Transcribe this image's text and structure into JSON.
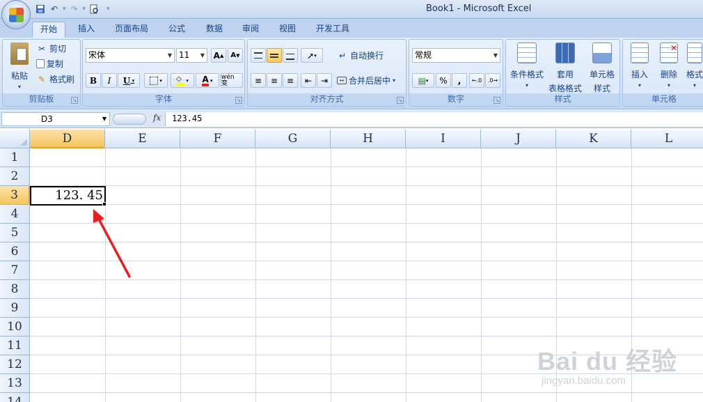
{
  "window": {
    "title": "Book1 - Microsoft Excel"
  },
  "qat": {
    "icons": [
      "save-icon",
      "undo-icon",
      "redo-icon",
      "print-preview-icon",
      "customize-icon"
    ]
  },
  "tabs": [
    "开始",
    "插入",
    "页面布局",
    "公式",
    "数据",
    "审阅",
    "视图",
    "开发工具"
  ],
  "ribbon": {
    "clipboard": {
      "label": "剪贴板",
      "paste": "粘贴",
      "cut": "剪切",
      "copy": "复制",
      "format_painter": "格式刷"
    },
    "font": {
      "label": "字体",
      "font_name": "宋体",
      "font_size": "11",
      "bold": "B",
      "italic": "I",
      "underline": "U",
      "grow": "A",
      "shrink": "A",
      "phonetic": "wén 变"
    },
    "alignment": {
      "label": "对齐方式",
      "wrap": "自动换行",
      "merge": "合并后居中"
    },
    "number": {
      "label": "数字",
      "format": "常规",
      "percent": "%",
      "comma": ","
    },
    "styles": {
      "label": "样式",
      "conditional": "条件格式",
      "table_line1": "套用",
      "table_line2": "表格格式",
      "cell_style_line1": "单元格",
      "cell_style_line2": "样式"
    },
    "cells": {
      "label": "单元格",
      "insert": "插入",
      "delete": "删除",
      "format": "格式"
    }
  },
  "formula_bar": {
    "name_box": "D3",
    "fx": "fx",
    "value": "123.45"
  },
  "sheet": {
    "columns": [
      "D",
      "E",
      "F",
      "G",
      "H",
      "I",
      "J",
      "K",
      "L"
    ],
    "rows": [
      "1",
      "2",
      "3",
      "4",
      "5",
      "6",
      "7",
      "8",
      "9",
      "10",
      "11",
      "12",
      "13",
      "14"
    ],
    "active_cell": {
      "ref": "D3",
      "value": "123. 45"
    }
  },
  "watermark": {
    "main": "Bai du 经验",
    "sub": "jingyan.baidu.com"
  },
  "colors": {
    "accent": "#e81e1e",
    "selected_header": "#f5c65c",
    "ribbon": "#dae7f8"
  }
}
